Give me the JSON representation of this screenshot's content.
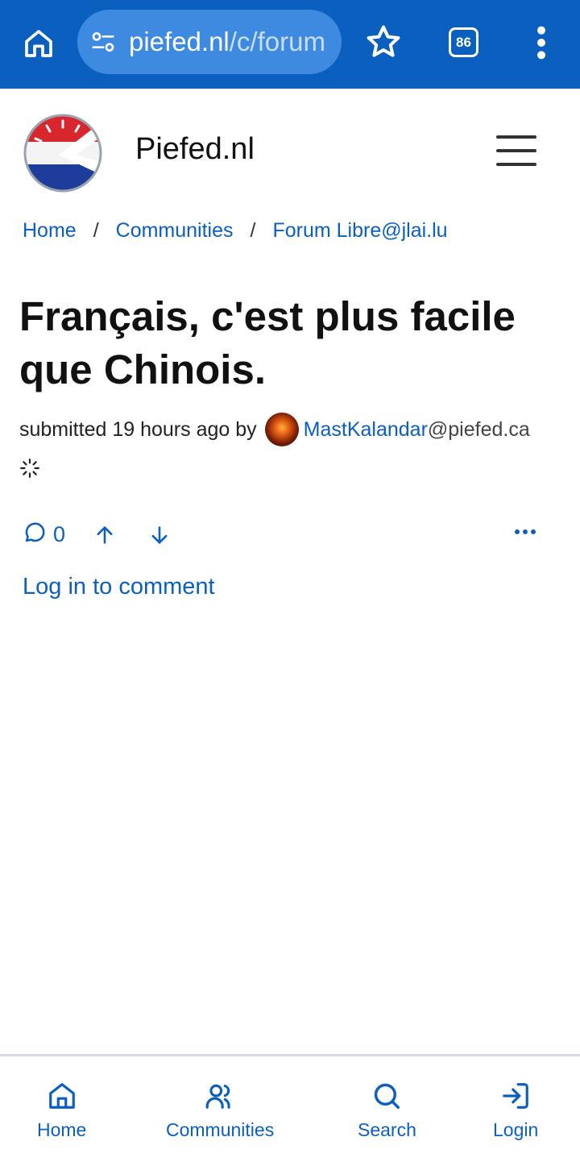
{
  "browser": {
    "url_host": "piefed.nl",
    "url_path": "/c/forum",
    "tab_count": "86"
  },
  "site": {
    "title": "Piefed.nl"
  },
  "breadcrumb": {
    "items": [
      "Home",
      "Communities",
      "Forum Libre@jlai.lu"
    ],
    "separator": "/"
  },
  "post": {
    "title": "Français, c'est plus facile que Chinois.",
    "submitted_prefix": "submitted 19 hours ago by",
    "author": "MastKalandar",
    "author_instance": "@piefed.ca",
    "comment_count": "0"
  },
  "actions": {
    "login_to_comment": "Log in to comment"
  },
  "bottom_nav": {
    "items": [
      {
        "label": "Home",
        "icon": "home-icon"
      },
      {
        "label": "Communities",
        "icon": "users-icon"
      },
      {
        "label": "Search",
        "icon": "search-icon"
      },
      {
        "label": "Login",
        "icon": "login-icon"
      }
    ]
  },
  "colors": {
    "browser_bar": "#0b5fbf",
    "link": "#0b5fbf",
    "text": "#111111"
  }
}
